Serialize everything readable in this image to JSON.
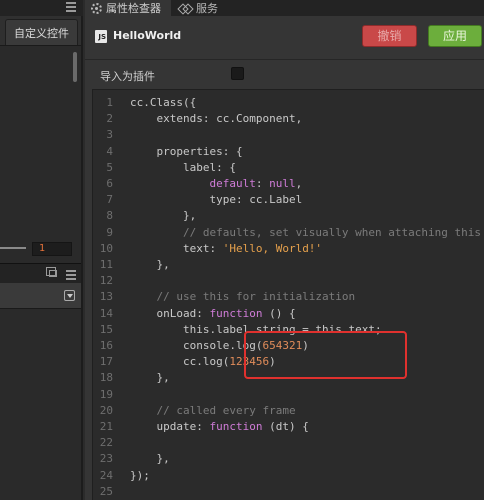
{
  "left_panel": {
    "tab_label": "自定义控件",
    "number_value": "1"
  },
  "tabs": {
    "inspector": "属性检查器",
    "services": "服务"
  },
  "header": {
    "js_badge": "JS",
    "file_name": "HelloWorld",
    "revert_label": "撤销",
    "apply_label": "应用"
  },
  "import_plugin": {
    "label": "导入为插件",
    "checked": false
  },
  "colors": {
    "revert_button": "#c94848",
    "apply_button": "#6cae3c",
    "highlight_box": "#e0312e"
  },
  "code_lines": [
    {
      "n": "1",
      "parts": [
        [
          "p",
          "cc.Class({"
        ]
      ]
    },
    {
      "n": "2",
      "parts": [
        [
          "p",
          "    extends: cc.Component,"
        ]
      ]
    },
    {
      "n": "3",
      "parts": []
    },
    {
      "n": "4",
      "parts": [
        [
          "p",
          "    properties: {"
        ]
      ]
    },
    {
      "n": "5",
      "parts": [
        [
          "p",
          "        label: {"
        ]
      ]
    },
    {
      "n": "6",
      "parts": [
        [
          "p",
          "            "
        ],
        [
          "k",
          "default"
        ],
        [
          "p",
          ": "
        ],
        [
          "k",
          "null"
        ],
        [
          "p",
          ","
        ]
      ]
    },
    {
      "n": "7",
      "parts": [
        [
          "p",
          "            type: cc.Label"
        ]
      ]
    },
    {
      "n": "8",
      "parts": [
        [
          "p",
          "        },"
        ]
      ]
    },
    {
      "n": "9",
      "parts": [
        [
          "c",
          "        // defaults, set visually when attaching this script t"
        ]
      ]
    },
    {
      "n": "10",
      "parts": [
        [
          "p",
          "        text: "
        ],
        [
          "s",
          "'Hello, World!'"
        ]
      ]
    },
    {
      "n": "11",
      "parts": [
        [
          "p",
          "    },"
        ]
      ]
    },
    {
      "n": "12",
      "parts": []
    },
    {
      "n": "13",
      "parts": [
        [
          "c",
          "    // use this for initialization"
        ]
      ]
    },
    {
      "n": "14",
      "parts": [
        [
          "p",
          "    onLoad: "
        ],
        [
          "k",
          "function"
        ],
        [
          "p",
          " () {"
        ]
      ]
    },
    {
      "n": "15",
      "parts": [
        [
          "p",
          "        this.label.string = this.text;"
        ]
      ]
    },
    {
      "n": "16",
      "parts": [
        [
          "p",
          "        console.log("
        ],
        [
          "n",
          "654321"
        ],
        [
          "p",
          ")"
        ]
      ]
    },
    {
      "n": "17",
      "parts": [
        [
          "p",
          "        cc.log("
        ],
        [
          "n",
          "123456"
        ],
        [
          "p",
          ")"
        ]
      ]
    },
    {
      "n": "18",
      "parts": [
        [
          "p",
          "    },"
        ]
      ]
    },
    {
      "n": "19",
      "parts": []
    },
    {
      "n": "20",
      "parts": [
        [
          "c",
          "    // called every frame"
        ]
      ]
    },
    {
      "n": "21",
      "parts": [
        [
          "p",
          "    update: "
        ],
        [
          "k",
          "function"
        ],
        [
          "p",
          " (dt) {"
        ]
      ]
    },
    {
      "n": "22",
      "parts": []
    },
    {
      "n": "23",
      "parts": [
        [
          "p",
          "    },"
        ]
      ]
    },
    {
      "n": "24",
      "parts": [
        [
          "p",
          "});"
        ]
      ]
    },
    {
      "n": "25",
      "parts": []
    }
  ]
}
